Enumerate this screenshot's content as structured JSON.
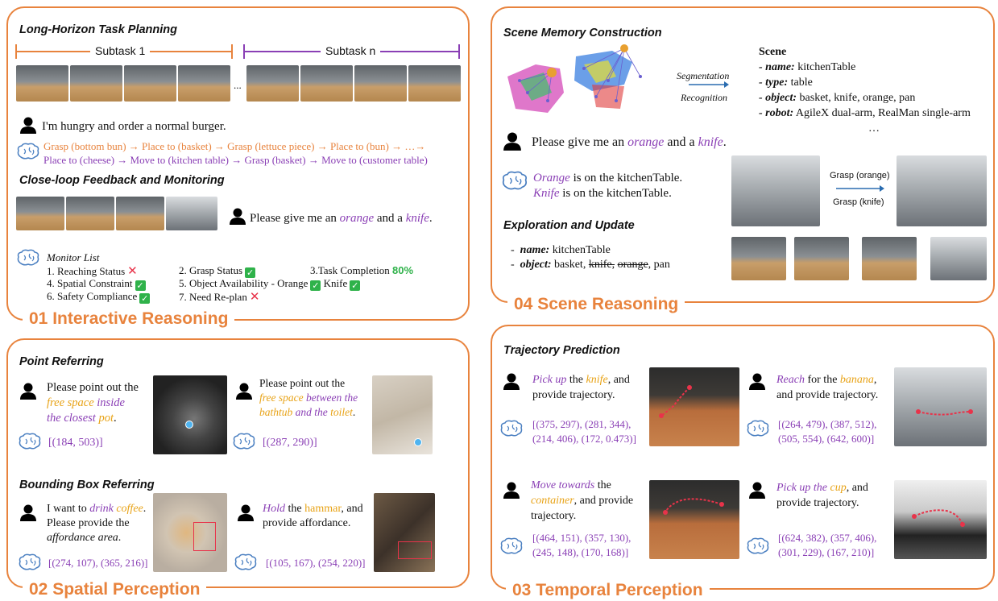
{
  "panels": {
    "interactive": "01 Interactive Reasoning",
    "spatial": "02 Spatial Perception",
    "temporal": "03 Temporal Perception",
    "scene": "04 Scene Reasoning"
  },
  "p1": {
    "long_horizon": "Long-Horizon Task Planning",
    "subtask1": "Subtask 1",
    "subtaskn": "Subtask n",
    "ellipsis": "...",
    "user_prompt": "I'm hungry and order a normal burger.",
    "plan_line1": "Grasp (bottom bun) → Place to (basket) → Grasp (lettuce piece) → Place to (bun) → …→",
    "plan_line2": "Place to (cheese) → Move to (kitchen table) → Grasp (basket) → Move to (customer table)",
    "closeloop": "Close-loop Feedback and Monitoring",
    "fb_prefix": "Please give me an",
    "fb_orange": "orange",
    "fb_and": "and a",
    "fb_knife": "knife",
    "fb_end": ".",
    "monitor_title": "Monitor List",
    "m1": "1. Reaching Status",
    "m2": "2. Grasp Status",
    "m3": "3.Task Completion",
    "m3_val": "80%",
    "m4": "4. Spatial Constraint",
    "m5": "5. Object Availability - Orange",
    "m5b": "Knife",
    "m6": "6. Safety Compliance",
    "m7": "7. Need Re-plan"
  },
  "p2": {
    "point_referring": "Point Referring",
    "q1_a": "Please point out the",
    "q1_b": "free space",
    "q1_c": "inside",
    "q1_d": "the closest",
    "q1_e": "pot",
    "q1_f": ".",
    "a1": "[(184, 503)]",
    "q2_a": "Please point out the",
    "q2_b": "free space",
    "q2_c": "between the",
    "q2_d": "bathtub",
    "q2_e": "and the",
    "q2_f": "toilet",
    "q2_g": ".",
    "a2": "[(287, 290)]",
    "bbox_referring": "Bounding Box Referring",
    "q3_a": "I want to",
    "q3_b": "drink",
    "q3_c": "coffee",
    "q3_d": ".",
    "q3_e": "Please provide the",
    "q3_f": "affordance area",
    "q3_g": ".",
    "a3": "[(274, 107), (365, 216)]",
    "q4_a": "Hold",
    "q4_b": "the",
    "q4_c": "hammar",
    "q4_d": ", and",
    "q4_e": "provide affordance.",
    "a4": "[(105, 167), (254, 220)]"
  },
  "p3": {
    "trajectory": "Trajectory Prediction",
    "t1_a": "Pick up",
    "t1_b": "the",
    "t1_c": "knife",
    "t1_d": ", and",
    "t1_e": "provide trajectory.",
    "t1_ans1": "[(375, 297), (281, 344),",
    "t1_ans2": "(214, 406), (172, 0.473)]",
    "t2_a": "Reach",
    "t2_b": "for the",
    "t2_c": "banana",
    "t2_d": ",",
    "t2_e": "and provide trajectory.",
    "t2_ans1": "[(264, 479), (387, 512),",
    "t2_ans2": "(505, 554), (642, 600)]",
    "t3_a": "Move towards",
    "t3_b": "the",
    "t3_c": "container",
    "t3_d": ", and provide",
    "t3_e": "trajectory.",
    "t3_ans1": "[(464, 151), (357, 130),",
    "t3_ans2": "(245, 148), (170, 168)]",
    "t4_a": "Pick up",
    "t4_b": "the",
    "t4_c": "cup",
    "t4_d": ", and",
    "t4_e": "provide trajectory.",
    "t4_ans1": "[(624, 382), (357, 406),",
    "t4_ans2": "(301, 229), (167, 210)]"
  },
  "p4": {
    "scene_memory": "Scene Memory Construction",
    "seg": "Segmentation",
    "rec": "Recognition",
    "scene_title": "Scene",
    "s_name_k": "- name:",
    "s_name_v": "kitchenTable",
    "s_type_k": "- type:",
    "s_type_v": "table",
    "s_obj_k": "- object:",
    "s_obj_v": "basket, knife, orange, pan",
    "s_robot_k": "- robot:",
    "s_robot_v": "AgileX dual-arm, RealMan single-arm",
    "s_more": "…",
    "q_a": "Please give me an",
    "q_b": "orange",
    "q_c": "and a",
    "q_d": "knife",
    "q_e": ".",
    "r1_a": "Orange",
    "r1_b": "is on the kitchenTable.",
    "r2_a": "Knife",
    "r2_b": "is on the kitchenTable.",
    "grasp1": "Grasp (orange)",
    "grasp2": "Grasp (knife)",
    "exploration": "Exploration and Update",
    "e_name_k": "name:",
    "e_name_v": "kitchenTable",
    "e_obj_k": "object:",
    "e_obj_v1": "basket,",
    "e_obj_v2": "knife,",
    "e_obj_v3": "orange",
    "e_obj_v4": ", pan"
  },
  "colors": {
    "accent": "#e8833d",
    "purple": "#8a3fb5",
    "highlight": "#e8a317",
    "green": "#2fb24a",
    "red": "#e8334a"
  }
}
